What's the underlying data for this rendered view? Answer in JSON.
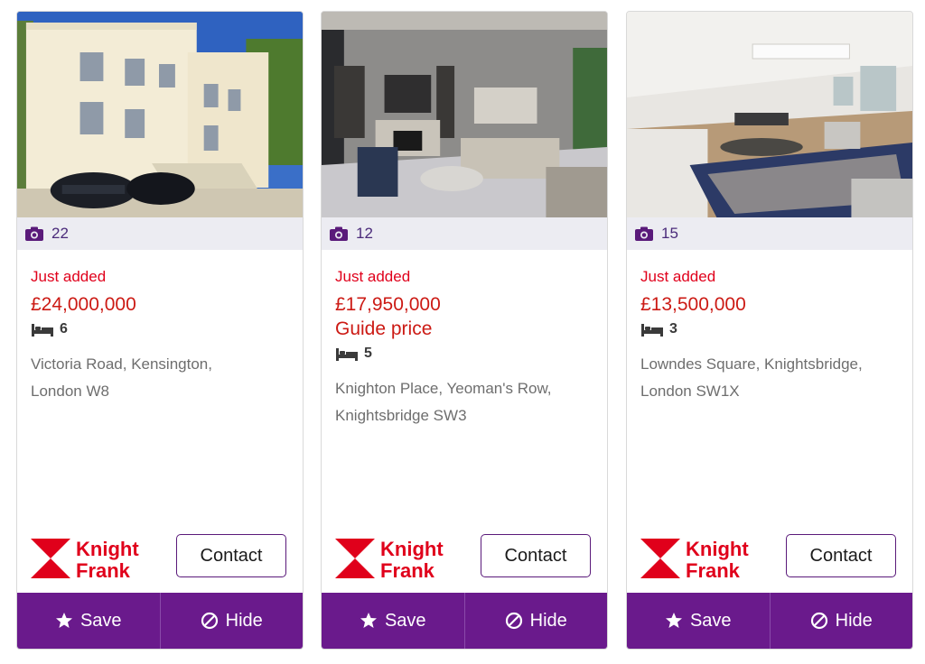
{
  "theme": {
    "accent": "#6a1a8c",
    "price_red": "#cc1a14",
    "photo_bar": "#ececf2"
  },
  "icons": {
    "photos": "camera-icon",
    "beds": "bed-icon",
    "save": "star-icon",
    "hide": "block-icon"
  },
  "listings": [
    {
      "photo_count": "22",
      "badge": "Just added",
      "price": "£24,000,000",
      "price_qualifier": "",
      "bedrooms": "6",
      "address_line1": "Victoria Road, Kensington,",
      "address_line2": "London W8",
      "agent": {
        "name_line1": "Knight",
        "name_line2": "Frank"
      },
      "contact_label": "Contact",
      "save_label": "Save",
      "hide_label": "Hide"
    },
    {
      "photo_count": "12",
      "badge": "Just added",
      "price": "£17,950,000",
      "price_qualifier": "Guide price",
      "bedrooms": "5",
      "address_line1": "Knighton Place, Yeoman's Row,",
      "address_line2": "Knightsbridge SW3",
      "agent": {
        "name_line1": "Knight",
        "name_line2": "Frank"
      },
      "contact_label": "Contact",
      "save_label": "Save",
      "hide_label": "Hide"
    },
    {
      "photo_count": "15",
      "badge": "Just added",
      "price": "£13,500,000",
      "price_qualifier": "",
      "bedrooms": "3",
      "address_line1": "Lowndes Square, Knightsbridge,",
      "address_line2": "London SW1X",
      "agent": {
        "name_line1": "Knight",
        "name_line2": "Frank"
      },
      "contact_label": "Contact",
      "save_label": "Save",
      "hide_label": "Hide"
    }
  ]
}
